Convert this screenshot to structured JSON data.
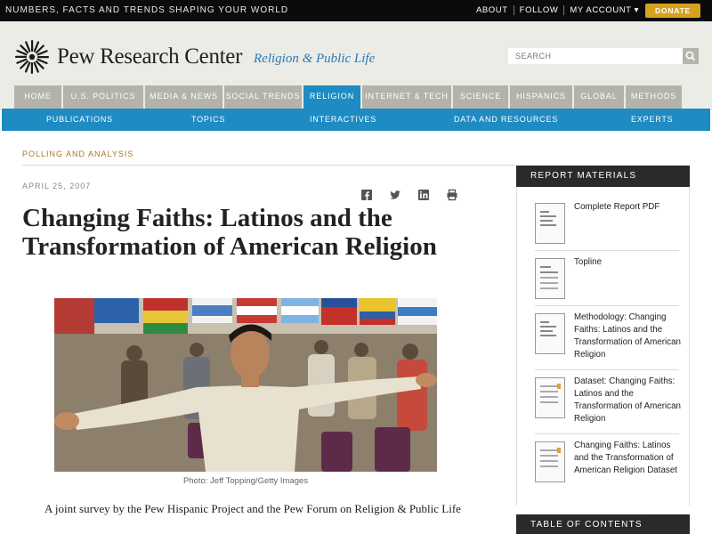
{
  "topbar": {
    "tagline": "NUMBERS, FACTS AND TRENDS SHAPING YOUR WORLD",
    "links": [
      "ABOUT",
      "FOLLOW",
      "MY ACCOUNT ▾"
    ],
    "donate": "DONATE"
  },
  "header": {
    "logo_text": "Pew Research Center",
    "logo_sub": "Religion & Public Life",
    "search_placeholder": "SEARCH"
  },
  "mainnav": [
    "HOME",
    "U.S. POLITICS",
    "MEDIA & NEWS",
    "SOCIAL TRENDS",
    "RELIGION",
    "INTERNET & TECH",
    "SCIENCE",
    "HISPANICS",
    "GLOBAL",
    "METHODS"
  ],
  "subnav": [
    "PUBLICATIONS",
    "TOPICS",
    "INTERACTIVES",
    "DATA AND RESOURCES",
    "EXPERTS"
  ],
  "article": {
    "section": "POLLING AND ANALYSIS",
    "date": "APRIL 25, 2007",
    "title": "Changing Faiths: Latinos and the Transformation of American Religion",
    "caption": "Photo: Jeff Topping/Getty Images",
    "intro": "A joint survey by the Pew Hispanic Project and the Pew Forum on Religion & Public Life"
  },
  "sidebar": {
    "heading": "REPORT MATERIALS",
    "materials": [
      "Complete Report PDF",
      "Topline",
      "Methodology: Changing Faiths: Latinos and the Transformation of American Religion",
      "Dataset: Changing Faiths: Latinos and the Transformation of American Religion",
      "Changing Faiths: Latinos and the Transformation of American Religion Dataset"
    ],
    "heading2": "TABLE OF CONTENTS"
  },
  "colors": {
    "accent": "#1e8bc3",
    "nav_gray": "#b3b3ac",
    "donate": "#d6a21e",
    "section": "#a9762a"
  }
}
